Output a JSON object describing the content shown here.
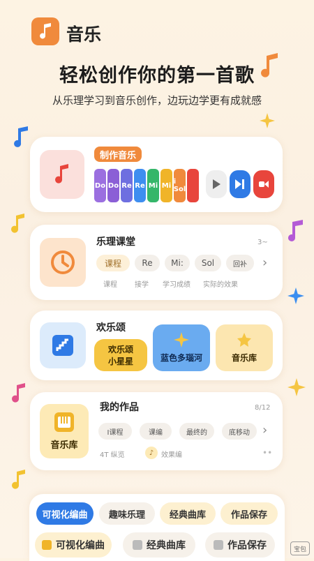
{
  "app": {
    "name": "音乐"
  },
  "hero": {
    "headline": "轻松创作你的第一首歌",
    "subline": "从乐理学习到音乐创作，边玩边学更有成就感"
  },
  "compose": {
    "badge": "制作音乐",
    "keys": [
      {
        "label": "Do",
        "color": "#9b6fe0"
      },
      {
        "label": "Do",
        "color": "#8b5fd6"
      },
      {
        "label": "Re",
        "color": "#6e6fe0"
      },
      {
        "label": "Re",
        "color": "#3e8ef0"
      },
      {
        "label": "Mi",
        "color": "#35b66a"
      },
      {
        "label": "Mi",
        "color": "#f0b429"
      },
      {
        "label": "i Sol",
        "color": "#f08a3c"
      },
      {
        "label": "",
        "color": "#e8453c"
      }
    ]
  },
  "theory": {
    "title": "乐理课堂",
    "corner": "3~",
    "chips": [
      "课程",
      "Re",
      "Mi:",
      "Sol",
      "回补"
    ],
    "tags": [
      "课程",
      "接学",
      "学习成绩",
      "实际的效果"
    ]
  },
  "ode": {
    "title": "欢乐颂",
    "cards": [
      {
        "line1": "欢乐颂",
        "line2": "小星星"
      },
      {
        "line1": "蓝色多瑙河",
        "line2": ""
      },
      {
        "line1": "音乐库",
        "line2": ""
      }
    ]
  },
  "works": {
    "title": "我的作品",
    "corner": "8/12",
    "tile_label": "音乐库",
    "chips": [
      "I课程",
      "课编",
      "最终的",
      "底移动"
    ],
    "footer_left": "4T 纵览",
    "footer_right": "效果编",
    "dots": "••"
  },
  "tabs": {
    "row1": [
      "可视化编曲",
      "趣味乐理",
      "经典曲库",
      "作品保存"
    ],
    "row2": [
      "可视化编曲",
      "经典曲库",
      "作品保存"
    ]
  },
  "watermark": "宝包",
  "colors": {
    "accent": "#f08a3c",
    "blue": "#2f7ae5",
    "yellow": "#f5c542"
  }
}
